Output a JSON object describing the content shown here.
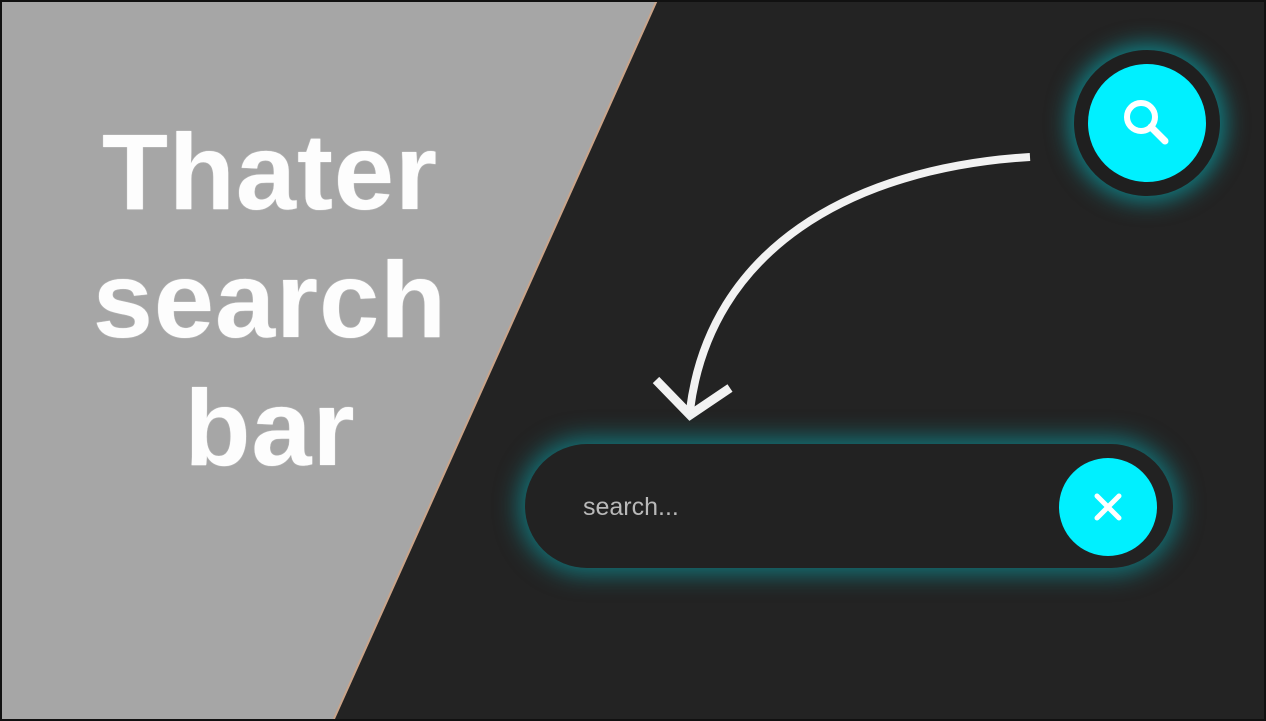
{
  "title": {
    "line1": "Thater",
    "line2": "search",
    "line3": "bar"
  },
  "search": {
    "placeholder": "search...",
    "value": ""
  },
  "icons": {
    "toggle": "search-icon",
    "clear": "close-icon",
    "transition": "curved-arrow-icon"
  },
  "colors": {
    "accent": "#00f0ff",
    "background_dark": "#232323",
    "background_light": "#a6a6a6",
    "text": "#ffffff"
  }
}
